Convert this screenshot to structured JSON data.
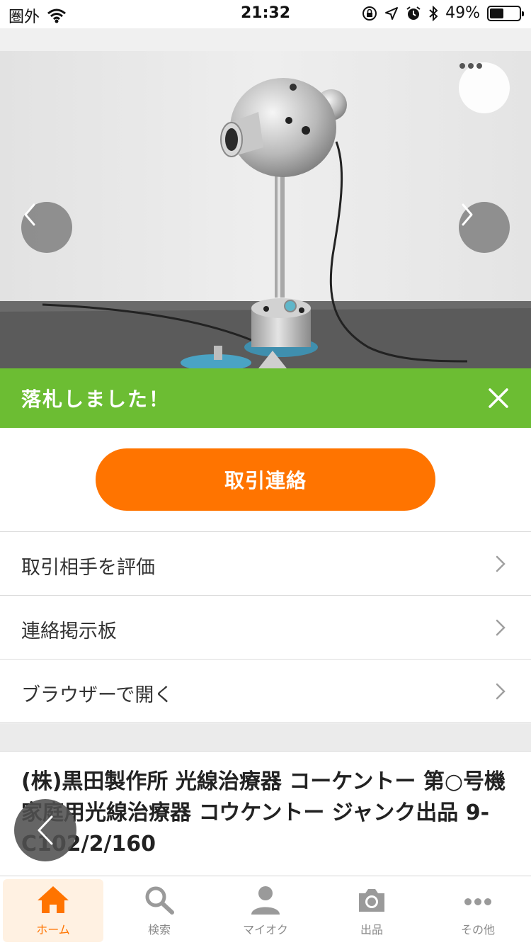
{
  "status_bar": {
    "carrier": "圏外",
    "time": "21:32",
    "battery": "49%",
    "battery_level": 0.49
  },
  "banner": {
    "text": "落札しました！"
  },
  "contact_button": {
    "label": "取引連絡"
  },
  "menu": {
    "items": [
      {
        "label": "取引相手を評価"
      },
      {
        "label": "連絡掲示板"
      },
      {
        "label": "ブラウザーで開く"
      }
    ]
  },
  "item": {
    "title": "(株)黒田製作所 光線治療器 コーケントー 第○号機 家庭用光線治療器 コウケントー ジャンク出品 9-C102/2/160"
  },
  "tabs": [
    {
      "label": "ホーム",
      "icon": "home-icon",
      "active": true
    },
    {
      "label": "検索",
      "icon": "search-icon",
      "active": false
    },
    {
      "label": "マイオク",
      "icon": "person-icon",
      "active": false
    },
    {
      "label": "出品",
      "icon": "camera-icon",
      "active": false
    },
    {
      "label": "その他",
      "icon": "more-dots-icon",
      "active": false
    }
  ],
  "colors": {
    "accent": "#ff7400",
    "banner_green": "#6cbd33",
    "tab_active_bg": "#fff1e2",
    "tab_inactive": "#8a8a8a"
  }
}
